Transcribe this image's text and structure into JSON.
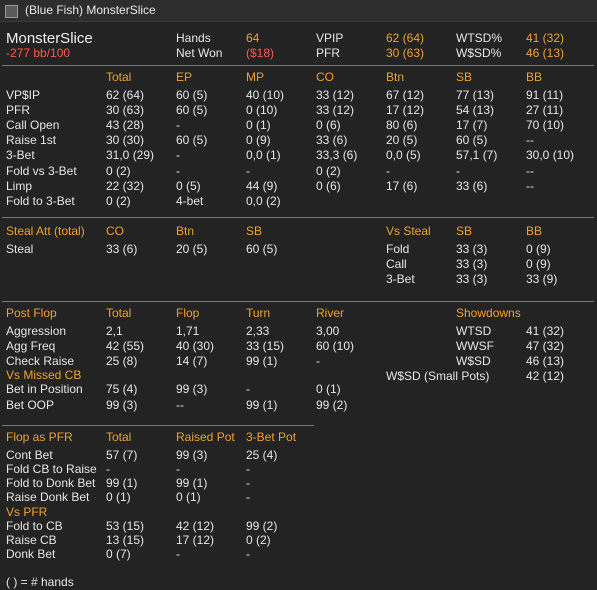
{
  "window": {
    "title": "(Blue Fish) MonsterSlice"
  },
  "player": {
    "name": "MonsterSlice",
    "winrate": "-277 bb/100"
  },
  "summary": {
    "hands_label": "Hands",
    "hands_value": "64",
    "netwon_label": "Net Won",
    "netwon_value": "($18)",
    "vpip_label": "VPIP",
    "vpip_value": "62 (64)",
    "pfr_label": "PFR",
    "pfr_value": "30 (63)",
    "wtsd_label": "WTSD%",
    "wtsd_value": "41 (32)",
    "wsd_label": "W$SD%",
    "wsd_value": "46 (13)"
  },
  "preflop": {
    "headers": [
      "Total",
      "EP",
      "MP",
      "CO",
      "Btn",
      "SB",
      "BB"
    ],
    "rows": [
      [
        "VP$IP",
        "62 (64)",
        "60 (5)",
        "40 (10)",
        "33 (12)",
        "67 (12)",
        "77 (13)",
        "91 (11)"
      ],
      [
        "PFR",
        "30 (63)",
        "60 (5)",
        "0 (10)",
        "33 (12)",
        "17 (12)",
        "54 (13)",
        "27 (11)"
      ],
      [
        "Call Open",
        "43 (28)",
        "-",
        "0 (1)",
        "0 (6)",
        "80 (6)",
        "17 (7)",
        "70 (10)"
      ],
      [
        "Raise 1st",
        "30 (30)",
        "60 (5)",
        "0 (9)",
        "33 (6)",
        "20 (5)",
        "60 (5)",
        "--"
      ],
      [
        "3-Bet",
        "31,0 (29)",
        "-",
        "0,0 (1)",
        "33,3 (6)",
        "0,0 (5)",
        "57,1 (7)",
        "30,0 (10)"
      ],
      [
        "Fold vs 3-Bet",
        "0 (2)",
        "-",
        "-",
        "0 (2)",
        "-",
        "-",
        "--"
      ],
      [
        "Limp",
        "22 (32)",
        "0 (5)",
        "44 (9)",
        "0 (6)",
        "17 (6)",
        "33 (6)",
        "--"
      ],
      [
        "Fold to 3-Bet",
        "0 (2)",
        "4-bet",
        "0,0 (2)",
        "",
        "",
        "",
        ""
      ]
    ]
  },
  "steal": {
    "headers": [
      "Steal Att (total)",
      "CO",
      "Btn",
      "SB"
    ],
    "row": [
      "Steal",
      "33 (6)",
      "20 (5)",
      "60 (5)"
    ],
    "vs_headers": [
      "Vs Steal",
      "SB",
      "BB"
    ],
    "vs_rows": [
      [
        "Fold",
        "33 (3)",
        "0 (9)"
      ],
      [
        "Call",
        "33 (3)",
        "0 (9)"
      ],
      [
        "3-Bet",
        "33 (3)",
        "33 (9)"
      ]
    ]
  },
  "postflop": {
    "headers": [
      "Post Flop",
      "Total",
      "Flop",
      "Turn",
      "River"
    ],
    "rows": [
      [
        "Aggression",
        "2,1",
        "1,71",
        "2,33",
        "3,00"
      ],
      [
        "Agg Freq",
        "42 (55)",
        "40 (30)",
        "33 (15)",
        "60 (10)"
      ],
      [
        "Check Raise",
        "25 (8)",
        "14 (7)",
        "99 (1)",
        "-"
      ]
    ],
    "missed_cb_label": "Vs Missed CB",
    "missed_rows": [
      [
        "Bet in Position",
        "75 (4)",
        "99 (3)",
        "-",
        "0 (1)"
      ],
      [
        "Bet OOP",
        "99 (3)",
        "--",
        "99 (1)",
        "99 (2)"
      ]
    ],
    "showdowns_label": "Showdowns",
    "showdowns": [
      [
        "WTSD",
        "41 (32)"
      ],
      [
        "WWSF",
        "47 (32)"
      ],
      [
        "W$SD",
        "46 (13)"
      ],
      [
        "W$SD (Small Pots)",
        "42 (12)"
      ]
    ]
  },
  "flop_pfr": {
    "headers": [
      "Flop as PFR",
      "Total",
      "Raised Pot",
      "3-Bet Pot"
    ],
    "rows": [
      [
        "Cont Bet",
        "57 (7)",
        "99 (3)",
        "25 (4)"
      ],
      [
        "Fold CB to Raise",
        "-",
        "-",
        "-"
      ],
      [
        "Fold to Donk Bet",
        "99 (1)",
        "99 (1)",
        "-"
      ],
      [
        "Raise Donk Bet",
        "0 (1)",
        "0 (1)",
        "-"
      ]
    ],
    "vs_pfr_label": "Vs PFR",
    "vs_rows": [
      [
        "Fold to CB",
        "53 (15)",
        "42 (12)",
        "99 (2)"
      ],
      [
        "Raise CB",
        "13 (15)",
        "17 (12)",
        "0 (2)"
      ],
      [
        "Donk Bet",
        "0 (7)",
        "-",
        "-"
      ]
    ]
  },
  "footer": {
    "note": "( ) = # hands"
  }
}
